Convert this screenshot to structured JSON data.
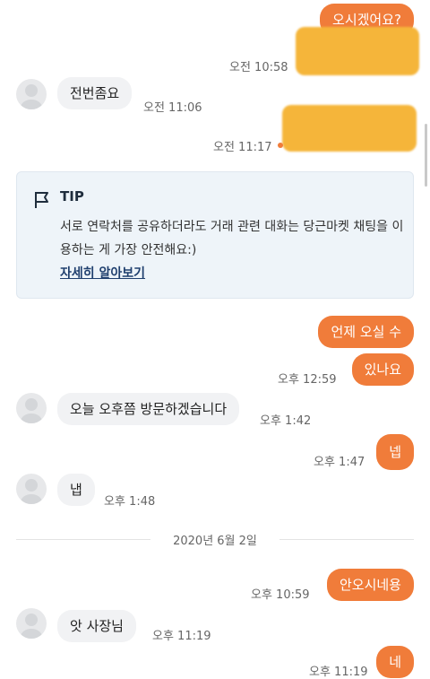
{
  "messages": {
    "m1": "오시겠어요?",
    "t1": "오전 10:58",
    "m2": "전번좀요",
    "t2": "오전 11:06",
    "t3": "오전 11:17",
    "m4a": "언제 오실 수",
    "m4b": "있나요",
    "t4": "오후 12:59",
    "m5": "오늘 오후쯤 방문하겠습니다",
    "t5": "오후 1:42",
    "m6": "넵",
    "t6": "오후 1:47",
    "m7": "냅",
    "t7": "오후 1:48",
    "m8": "안오시네용",
    "t8": "오후 10:59",
    "m9": "앗 사장님",
    "t9": "오후 11:19",
    "m10": "네",
    "t10": "오후 11:19"
  },
  "tip": {
    "title": "TIP",
    "text": "서로 연락처를 공유하더라도 거래 관련 대화는 당근마켓 채팅을 이용하는 게 가장 안전해요:)",
    "link": "자세히 알아보기"
  },
  "date_divider": "2020년 6월 2일",
  "colors": {
    "outgoing_bubble": "#f07c3a",
    "incoming_bubble": "#f1f2f4",
    "tip_background": "#eef4f9",
    "tip_link": "#1f3f6e"
  }
}
